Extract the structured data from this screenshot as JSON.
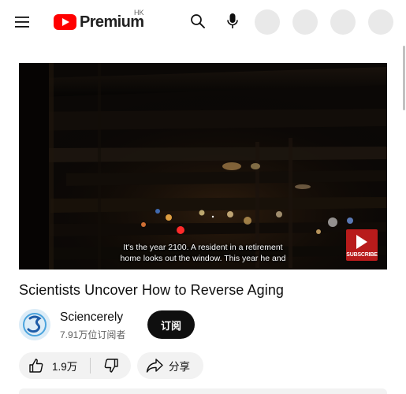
{
  "header": {
    "logo_text": "Premium",
    "region": "HK",
    "icons": [
      "menu-icon",
      "youtube-logo-icon",
      "search-icon",
      "microphone-icon"
    ]
  },
  "video": {
    "captions": [
      "It's the year 2100. A resident in a retirement",
      "home looks out the window. This year he and"
    ],
    "watermark_label": "SUBSCRIBE",
    "title": "Scientists Uncover How to Reverse Aging"
  },
  "channel": {
    "name": "Sciencerely",
    "subscribers": "7.91万位订阅者",
    "subscribe_label": "订阅"
  },
  "actions": {
    "like_count": "1.9万",
    "share_label": "分享"
  },
  "colors": {
    "brand_red": "#ff0000",
    "subscribe_button": "#0f0f0f",
    "pill_bg": "#f2f2f2"
  }
}
